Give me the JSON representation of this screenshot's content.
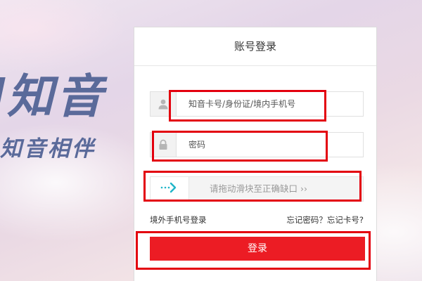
{
  "brand": {
    "name": "知音",
    "slogan": "知音相伴",
    "color": "#5a6a9a"
  },
  "login": {
    "title": "账号登录",
    "username_placeholder": "知音卡号/身份证/境内手机号",
    "password_placeholder": "密码",
    "slider_text": "请拖动滑块至正确缺口 ››",
    "overseas_link": "境外手机号登录",
    "forgot_link": "忘记密码？忘记卡号?",
    "submit_label": "登录",
    "accent_color": "#ec1c24"
  },
  "icons": {
    "username": "user-icon",
    "password": "lock-icon",
    "slider": "arrow-right-icon"
  }
}
